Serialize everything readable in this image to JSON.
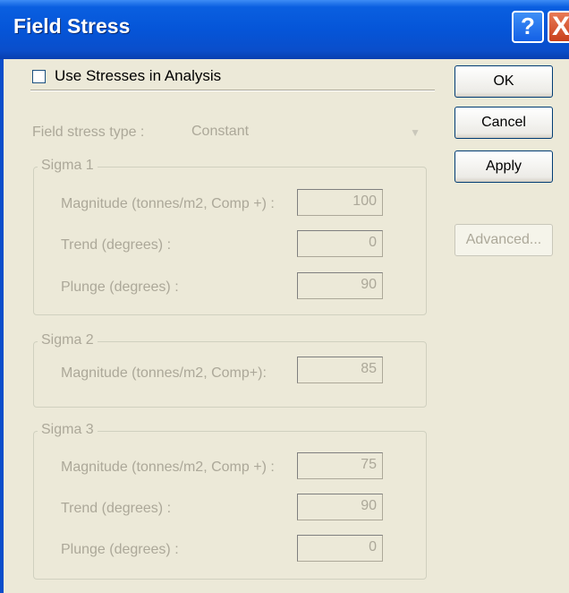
{
  "window": {
    "title": "Field Stress",
    "help_glyph": "?",
    "close_glyph": "X"
  },
  "use_stresses": {
    "label": "Use Stresses in Analysis",
    "checked": false
  },
  "buttons": {
    "ok": "OK",
    "cancel": "Cancel",
    "apply": "Apply",
    "advanced": "Advanced..."
  },
  "field_stress_type": {
    "label": "Field stress type :",
    "value": "Constant"
  },
  "sigma1": {
    "title": "Sigma 1",
    "magnitude": {
      "label": "Magnitude (tonnes/m2, Comp +) :",
      "value": "100"
    },
    "trend": {
      "label": "Trend (degrees) :",
      "value": "0"
    },
    "plunge": {
      "label": "Plunge (degrees) :",
      "value": "90"
    }
  },
  "sigma2": {
    "title": "Sigma 2",
    "magnitude": {
      "label": "Magnitude (tonnes/m2, Comp+):",
      "value": "85"
    }
  },
  "sigma3": {
    "title": "Sigma 3",
    "magnitude": {
      "label": "Magnitude (tonnes/m2, Comp +) :",
      "value": "75"
    },
    "trend": {
      "label": "Trend (degrees) :",
      "value": "90"
    },
    "plunge": {
      "label": "Plunge (degrees) :",
      "value": "0"
    }
  },
  "colors": {
    "title_bar": "#0a4ecb",
    "dialog_bg": "#ece9d8",
    "disabled_text": "#aca899"
  }
}
